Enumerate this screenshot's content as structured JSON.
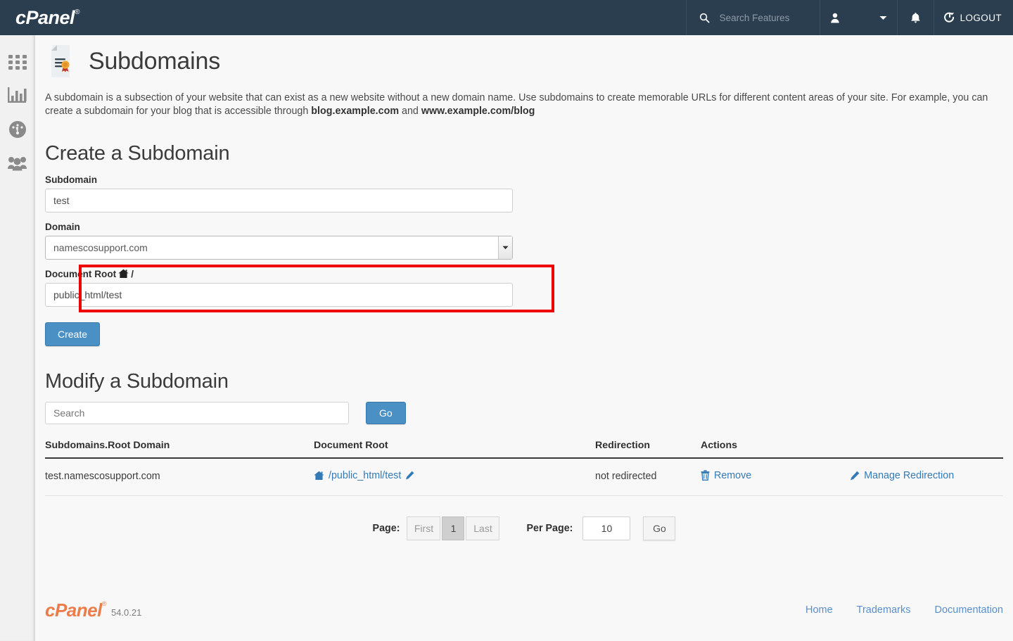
{
  "topbar": {
    "brand": "cPanel",
    "brand_reg": "®",
    "search_placeholder": "Search Features",
    "search_value": "",
    "search_icon": "search-icon",
    "user_icon": "user-icon",
    "user_caret_icon": "chevron-down-icon",
    "bell_icon": "bell-icon",
    "logout_icon": "logout-icon",
    "logout_label": "LOGOUT"
  },
  "sidebar": {
    "items": [
      {
        "icon": "grid-apps-icon",
        "name": "sidebar-item-apps"
      },
      {
        "icon": "bar-chart-icon",
        "name": "sidebar-item-statistics"
      },
      {
        "icon": "gauge-icon",
        "name": "sidebar-item-dashboard"
      },
      {
        "icon": "users-icon",
        "name": "sidebar-item-users"
      }
    ]
  },
  "page": {
    "title": "Subdomains",
    "title_icon": "certificate-document-icon",
    "intro_part1": "A subdomain is a subsection of your website that can exist as a new website without a new domain name. Use subdomains to create memorable URLs for different content areas of your site. For example, you can create a subdomain for your blog that is accessible through ",
    "intro_bold1": "blog.example.com",
    "intro_mid": " and ",
    "intro_bold2": "www.example.com/blog"
  },
  "create": {
    "heading": "Create a Subdomain",
    "subdomain_label": "Subdomain",
    "subdomain_value": "test",
    "domain_label": "Domain",
    "domain_value": "namescosupport.com",
    "domain_options": [
      "namescosupport.com"
    ],
    "docroot_label": "Document Root",
    "docroot_label_suffix": "/",
    "docroot_home_icon": "home-icon",
    "docroot_value": "public_html/test",
    "create_button": "Create",
    "highlight_color": "#ef0000",
    "accent_color": "#4a90c4"
  },
  "modify": {
    "heading": "Modify a Subdomain",
    "search_placeholder": "Search",
    "search_value": "",
    "go_button": "Go",
    "columns": [
      "Subdomains.Root Domain",
      "Document Root",
      "Redirection",
      "Actions"
    ],
    "rows": [
      {
        "subdomain": "test.namescosupport.com",
        "docroot": "/public_html/test",
        "docroot_home_icon": "home-icon",
        "docroot_edit_icon": "pencil-icon",
        "redirection": "not redirected",
        "remove_label": "Remove",
        "remove_icon": "trash-icon",
        "manage_label": "Manage Redirection",
        "manage_icon": "pencil-icon"
      }
    ]
  },
  "pagination": {
    "page_label": "Page:",
    "first_label": "First",
    "current_page": "1",
    "last_label": "Last",
    "per_page_label": "Per Page:",
    "per_page_value": "10",
    "go_label": "Go"
  },
  "footer": {
    "logo": "cPanel",
    "logo_reg": "®",
    "version": "54.0.21",
    "links": [
      "Home",
      "Trademarks",
      "Documentation"
    ]
  }
}
